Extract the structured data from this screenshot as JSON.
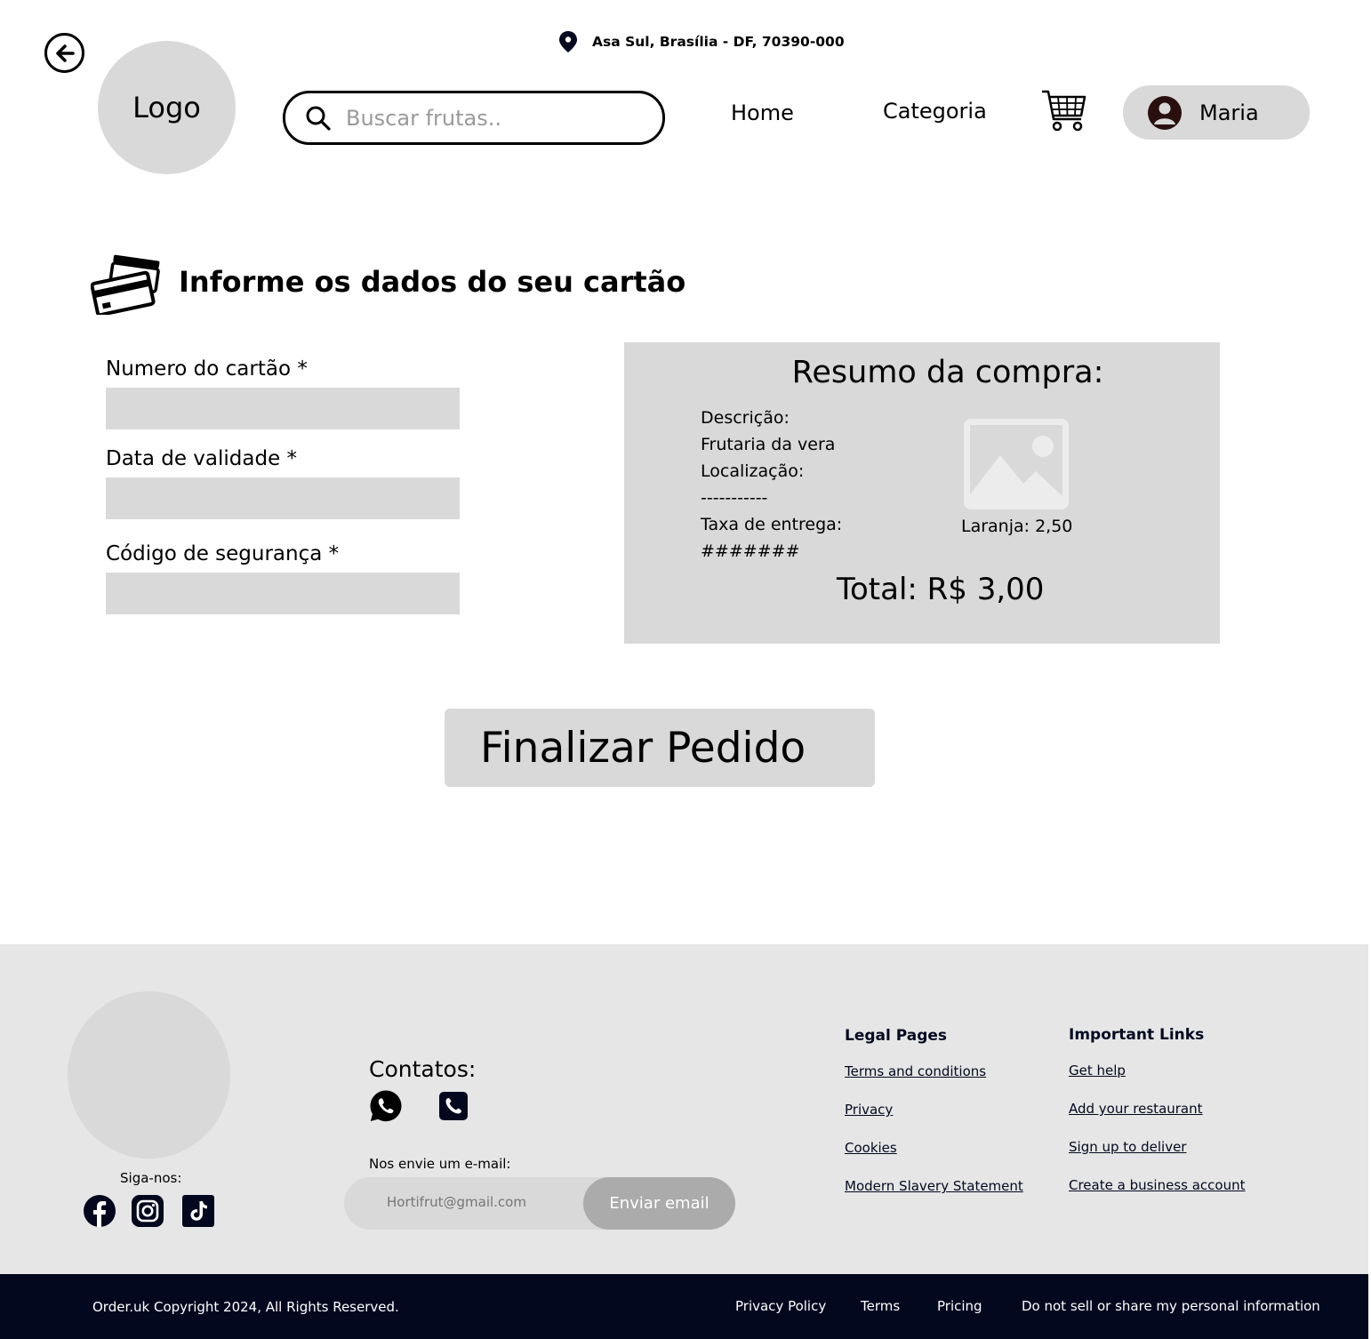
{
  "header": {
    "logo_text": "Logo",
    "address": "Asa Sul, Brasília - DF, 70390-000",
    "search_placeholder": "Buscar frutas..",
    "nav_home": "Home",
    "nav_categoria": "Categoria",
    "user_name": "Maria"
  },
  "form": {
    "title": "Informe os dados do seu cartão",
    "card_number_label": "Numero do cartão *",
    "expiry_label": "Data de validade *",
    "security_code_label": "Código de segurança *",
    "card_number_value": "",
    "expiry_value": "",
    "security_code_value": ""
  },
  "summary": {
    "title": "Resumo da compra:",
    "lines": [
      "Descrição:",
      "Frutaria da vera",
      "Localização:",
      "-----------",
      "Taxa de entrega:",
      "#######"
    ],
    "item_price": "Laranja: 2,50",
    "total": "Total: R$ 3,00"
  },
  "finalizar_label": "Finalizar Pedido",
  "footer": {
    "siga": "Siga-nos:",
    "contatos": "Contatos:",
    "email_prompt": "Nos envie um e-mail:",
    "email_placeholder": "Hortifrut@gmail.com",
    "email_button": "Enviar email",
    "legal_title": "Legal Pages",
    "legal_links": [
      "Terms and conditions",
      "Privacy",
      "Cookies",
      "Modern Slavery Statement"
    ],
    "important_title": "Important Links",
    "important_links": [
      "Get help",
      "Add your restaurant",
      "Sign up to deliver",
      "Create a business account"
    ]
  },
  "bottom_bar": {
    "copyright": "Order.uk Copyright 2024, All Rights Reserved.",
    "links": [
      "Privacy Policy",
      "Terms",
      "Pricing",
      "Do not sell or share my personal information"
    ]
  },
  "colors": {
    "gray_fill": "#d9d9d9",
    "footer_bg": "#e6e6e6",
    "bottom_bar_bg": "#03081f",
    "email_button": "#ababab"
  },
  "icons": [
    "back-arrow-icon",
    "location-pin-icon",
    "search-icon",
    "cart-icon",
    "user-avatar-icon",
    "credit-cards-icon",
    "image-placeholder-icon",
    "facebook-icon",
    "instagram-icon",
    "tiktok-icon",
    "whatsapp-icon",
    "phone-icon"
  ]
}
